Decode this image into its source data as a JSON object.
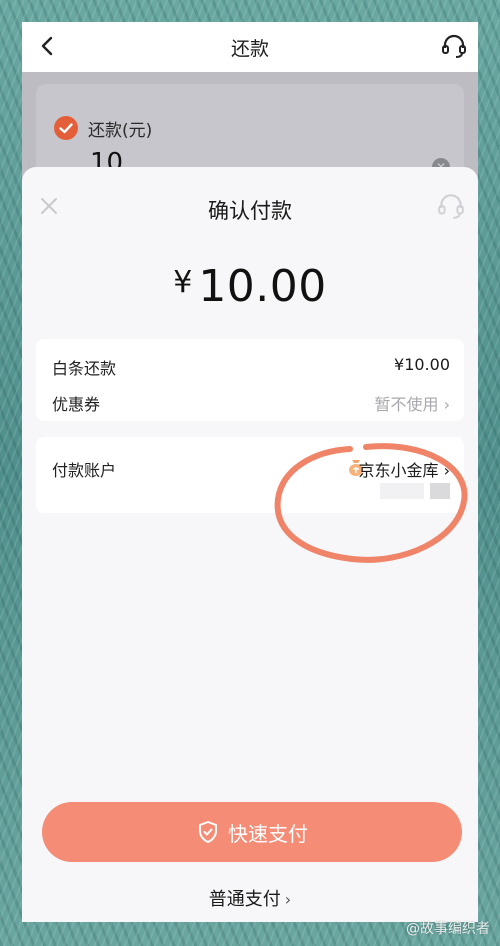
{
  "nav": {
    "title": "还款"
  },
  "background_page": {
    "label": "还款(元)",
    "amount": "10"
  },
  "sheet": {
    "title": "确认付款",
    "currency_symbol": "¥",
    "amount": "10.00",
    "rows": [
      {
        "label": "白条还款",
        "value": "¥10.00"
      },
      {
        "label": "优惠券",
        "value": "暂不使用 ›"
      }
    ],
    "payment_account": {
      "label": "付款账户",
      "value": "京东小金库 ›"
    },
    "primary_button": "快速支付",
    "secondary_link": "普通支付"
  },
  "watermark": "@故事编织者",
  "colors": {
    "accent": "#f58c76",
    "check": "#e25f3a",
    "annotation": "#ef8468"
  }
}
